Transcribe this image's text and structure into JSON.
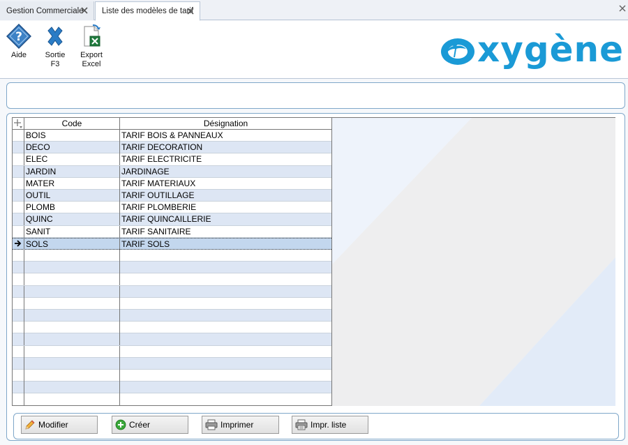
{
  "tabs": [
    {
      "label": "Gestion Commerciale",
      "active": false
    },
    {
      "label": "Liste des modèles de tarif",
      "active": true
    }
  ],
  "toolbar": {
    "buttons": [
      {
        "label": "Aide",
        "icon": "help-icon"
      },
      {
        "label": "Sortie\nF3",
        "icon": "exit-icon"
      },
      {
        "label": "Export\nExcel",
        "icon": "excel-export-icon"
      }
    ]
  },
  "logo": {
    "text": "xygène",
    "color": "#1a9ad6"
  },
  "grid": {
    "columns": [
      "Code",
      "Désignation"
    ],
    "rows": [
      {
        "code": "BOIS",
        "designation": "TARIF BOIS & PANNEAUX"
      },
      {
        "code": "DECO",
        "designation": "TARIF DECORATION"
      },
      {
        "code": "ELEC",
        "designation": "TARIF ELECTRICITE"
      },
      {
        "code": "JARDIN",
        "designation": "JARDINAGE"
      },
      {
        "code": "MATER",
        "designation": "TARIF MATERIAUX"
      },
      {
        "code": "OUTIL",
        "designation": "TARIF OUTILLAGE"
      },
      {
        "code": "PLOMB",
        "designation": "TARIF PLOMBERIE"
      },
      {
        "code": "QUINC",
        "designation": "TARIF QUINCAILLERIE"
      },
      {
        "code": "SANIT",
        "designation": "TARIF SANITAIRE"
      },
      {
        "code": "SOLS",
        "designation": "TARIF SOLS"
      }
    ],
    "selected_code": "SOLS"
  },
  "actions": {
    "modify": "Modifier",
    "create": "Créer",
    "print": "Imprimer",
    "print_list": "Impr. liste"
  },
  "colors": {
    "accent": "#1a9ad6",
    "row_alt": "#dde6f4",
    "row_selected": "#c3d7ee",
    "panel_border": "#7fa7c9"
  }
}
